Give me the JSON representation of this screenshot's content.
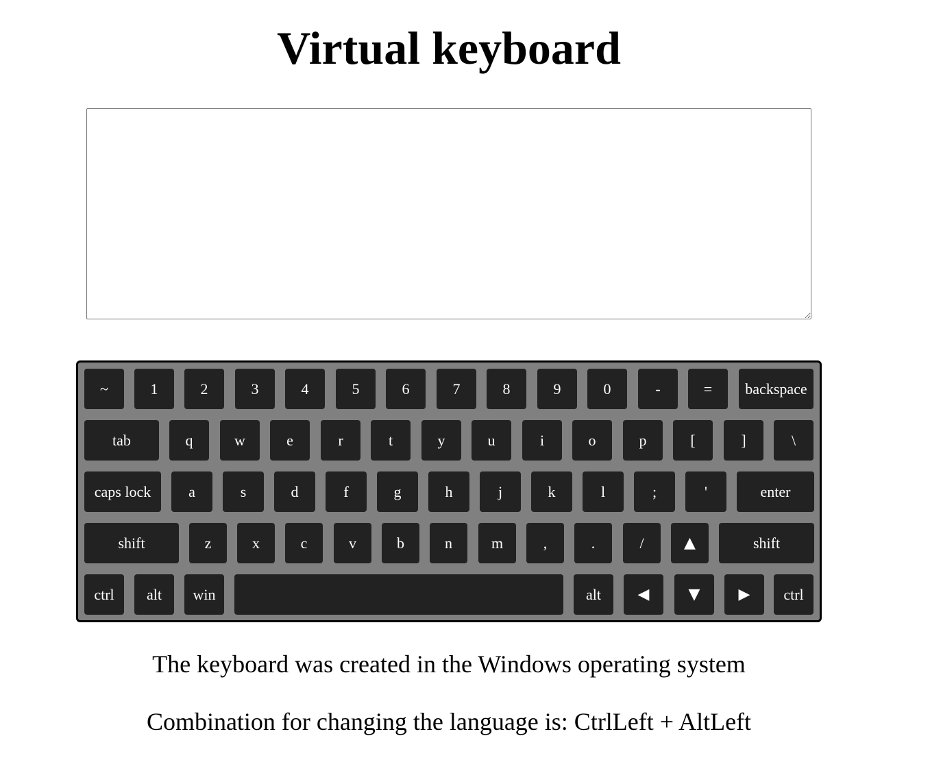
{
  "page": {
    "title": "Virtual keyboard",
    "textarea_value": "",
    "note_os": "The keyboard was created in the Windows operating system",
    "note_lang": "Combination for changing the language is: CtrlLeft + AltLeft"
  },
  "colors": {
    "keyboard_bg": "#808080",
    "key_bg": "#232223",
    "key_text": "#ffffff"
  },
  "keyboard": {
    "rows": [
      [
        {
          "id": "backquote",
          "label": "~"
        },
        {
          "id": "digit1",
          "label": "1"
        },
        {
          "id": "digit2",
          "label": "2"
        },
        {
          "id": "digit3",
          "label": "3"
        },
        {
          "id": "digit4",
          "label": "4"
        },
        {
          "id": "digit5",
          "label": "5"
        },
        {
          "id": "digit6",
          "label": "6"
        },
        {
          "id": "digit7",
          "label": "7"
        },
        {
          "id": "digit8",
          "label": "8"
        },
        {
          "id": "digit9",
          "label": "9"
        },
        {
          "id": "digit0",
          "label": "0"
        },
        {
          "id": "minus",
          "label": "-"
        },
        {
          "id": "equal",
          "label": "="
        },
        {
          "id": "backspace",
          "label": "backspace"
        }
      ],
      [
        {
          "id": "tab",
          "label": "tab"
        },
        {
          "id": "key-q",
          "label": "q"
        },
        {
          "id": "key-w",
          "label": "w"
        },
        {
          "id": "key-e",
          "label": "e"
        },
        {
          "id": "key-r",
          "label": "r"
        },
        {
          "id": "key-t",
          "label": "t"
        },
        {
          "id": "key-y",
          "label": "y"
        },
        {
          "id": "key-u",
          "label": "u"
        },
        {
          "id": "key-i",
          "label": "i"
        },
        {
          "id": "key-o",
          "label": "o"
        },
        {
          "id": "key-p",
          "label": "p"
        },
        {
          "id": "bracket-left",
          "label": "["
        },
        {
          "id": "bracket-right",
          "label": "]"
        },
        {
          "id": "backslash",
          "label": "\\"
        }
      ],
      [
        {
          "id": "caps-lock",
          "label": "caps lock"
        },
        {
          "id": "key-a",
          "label": "a"
        },
        {
          "id": "key-s",
          "label": "s"
        },
        {
          "id": "key-d",
          "label": "d"
        },
        {
          "id": "key-f",
          "label": "f"
        },
        {
          "id": "key-g",
          "label": "g"
        },
        {
          "id": "key-h",
          "label": "h"
        },
        {
          "id": "key-j",
          "label": "j"
        },
        {
          "id": "key-k",
          "label": "k"
        },
        {
          "id": "key-l",
          "label": "l"
        },
        {
          "id": "semicolon",
          "label": ";"
        },
        {
          "id": "quote",
          "label": "'"
        },
        {
          "id": "enter",
          "label": "enter"
        }
      ],
      [
        {
          "id": "shift-left",
          "label": "shift"
        },
        {
          "id": "key-z",
          "label": "z"
        },
        {
          "id": "key-x",
          "label": "x"
        },
        {
          "id": "key-c",
          "label": "c"
        },
        {
          "id": "key-v",
          "label": "v"
        },
        {
          "id": "key-b",
          "label": "b"
        },
        {
          "id": "key-n",
          "label": "n"
        },
        {
          "id": "key-m",
          "label": "m"
        },
        {
          "id": "comma",
          "label": ","
        },
        {
          "id": "period",
          "label": "."
        },
        {
          "id": "slash",
          "label": "/"
        },
        {
          "id": "arrow-up",
          "label": "▲"
        },
        {
          "id": "shift-right",
          "label": "shift"
        }
      ],
      [
        {
          "id": "ctrl-left",
          "label": "ctrl"
        },
        {
          "id": "alt-left",
          "label": "alt"
        },
        {
          "id": "win",
          "label": "win"
        },
        {
          "id": "space",
          "label": ""
        },
        {
          "id": "alt-right",
          "label": "alt"
        },
        {
          "id": "arrow-left",
          "label": "◀"
        },
        {
          "id": "arrow-down",
          "label": "▼"
        },
        {
          "id": "arrow-right",
          "label": "▶"
        },
        {
          "id": "ctrl-right",
          "label": "ctrl"
        }
      ]
    ]
  }
}
